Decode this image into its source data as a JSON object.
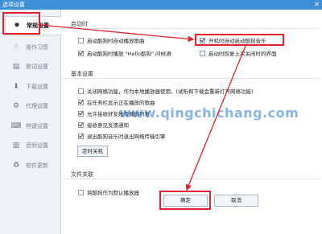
{
  "window": {
    "title": "选项设置",
    "close_glyph": "✕"
  },
  "sidebar": {
    "items": [
      {
        "label": "常规设置",
        "icon": "gear-icon",
        "glyph": "✹",
        "active": true
      },
      {
        "label": "操作习惯",
        "icon": "gesture-icon",
        "glyph": "☝",
        "active": false
      },
      {
        "label": "歌词设置",
        "icon": "lyrics-icon",
        "glyph": "▤",
        "active": false
      },
      {
        "label": "下载设置",
        "icon": "download-icon",
        "glyph": "⬇",
        "active": false
      },
      {
        "label": "代理设置",
        "icon": "proxy-icon",
        "glyph": "⚙",
        "active": false
      },
      {
        "label": "热键设置",
        "icon": "keyboard-icon",
        "glyph": "⌨",
        "active": false
      },
      {
        "label": "音频设置",
        "icon": "audio-icon",
        "glyph": "▥",
        "active": false
      },
      {
        "label": "软件更新",
        "icon": "update-icon",
        "glyph": "♻",
        "active": false
      }
    ]
  },
  "startup": {
    "title": "启动时",
    "auto_play": {
      "label": "启动酷狗时自动播放歌曲",
      "checked": false
    },
    "launch_on_boot": {
      "label": "开机时自动启动酷狗音乐",
      "checked": true
    },
    "hello_sound": {
      "label": "启动酷狗时播放 \"Hello酷狗\" 问候语",
      "checked": true
    },
    "restore_ui": {
      "label": "启动时恢复上次关闭时的界面",
      "checked": false
    }
  },
  "basic": {
    "title": "基本设置",
    "close_network": {
      "label": "关闭网络功能，作为本地播放器使用。(试听和下载会重新打开网络功能)",
      "checked": false
    },
    "taskbar_show": {
      "label": "在任务栏显示正在播放的歌曲",
      "checked": true
    },
    "allow_receive": {
      "label": "允许接收好友推荐播放列表",
      "checked": true
    },
    "feedback": {
      "label": "接收意见反馈通知",
      "checked": true
    },
    "exit_engine": {
      "label": "退出酷狗音乐时退出网络传输引擎",
      "checked": true
    },
    "timer_button": "定时关机"
  },
  "file_assoc": {
    "title": "文件关联",
    "default_player": {
      "label": "将酷狗作为默认播放器",
      "checked": false
    }
  },
  "footer": {
    "ok_label": "确定",
    "cancel_label": "取消"
  },
  "watermark": "www.qingchichang.com",
  "colors": {
    "titlebar": "#3d8fd6",
    "highlight": "#e0232f",
    "sidebar_bg": "#eef1f5"
  }
}
